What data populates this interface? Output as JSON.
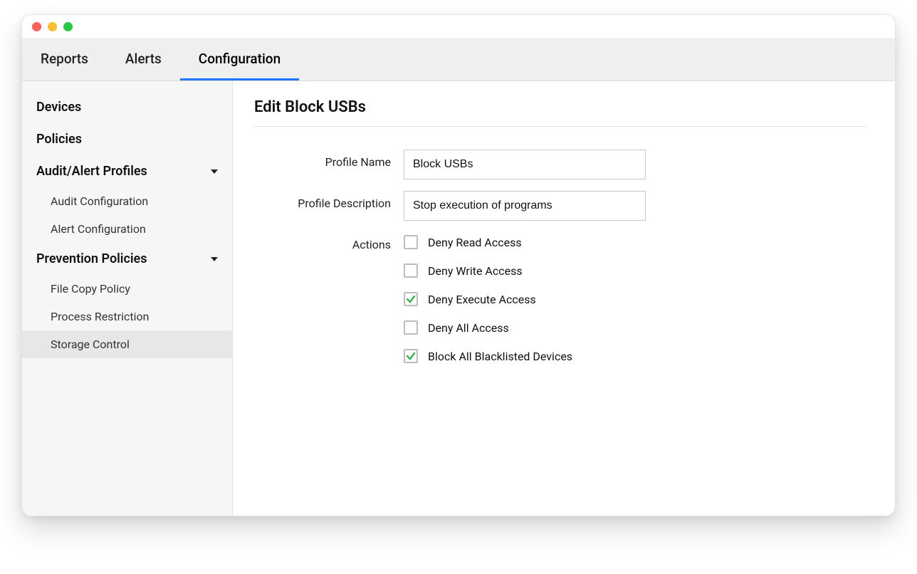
{
  "tabs": [
    {
      "label": "Reports",
      "active": false
    },
    {
      "label": "Alerts",
      "active": false
    },
    {
      "label": "Configuration",
      "active": true
    }
  ],
  "sidebar": {
    "devices": "Devices",
    "policies": "Policies",
    "audit_group": "Audit/Alert Profiles",
    "audit_children": [
      {
        "label": "Audit Configuration",
        "active": false
      },
      {
        "label": "Alert Configuration",
        "active": false
      }
    ],
    "prevention_group": "Prevention Policies",
    "prevention_children": [
      {
        "label": "File Copy Policy",
        "active": false
      },
      {
        "label": "Process Restriction",
        "active": false
      },
      {
        "label": "Storage Control",
        "active": true
      }
    ]
  },
  "page": {
    "title": "Edit Block USBs",
    "profile_name_label": "Profile Name",
    "profile_name_value": "Block USBs",
    "profile_desc_label": "Profile Description",
    "profile_desc_value": "Stop execution of programs",
    "actions_label": "Actions",
    "actions": [
      {
        "label": "Deny Read Access",
        "checked": false
      },
      {
        "label": "Deny Write Access",
        "checked": false
      },
      {
        "label": "Deny Execute Access",
        "checked": true
      },
      {
        "label": "Deny All Access",
        "checked": false
      },
      {
        "label": "Block All Blacklisted Devices",
        "checked": true
      }
    ]
  },
  "colors": {
    "accent": "#1e73ff",
    "check": "#39b54a"
  }
}
